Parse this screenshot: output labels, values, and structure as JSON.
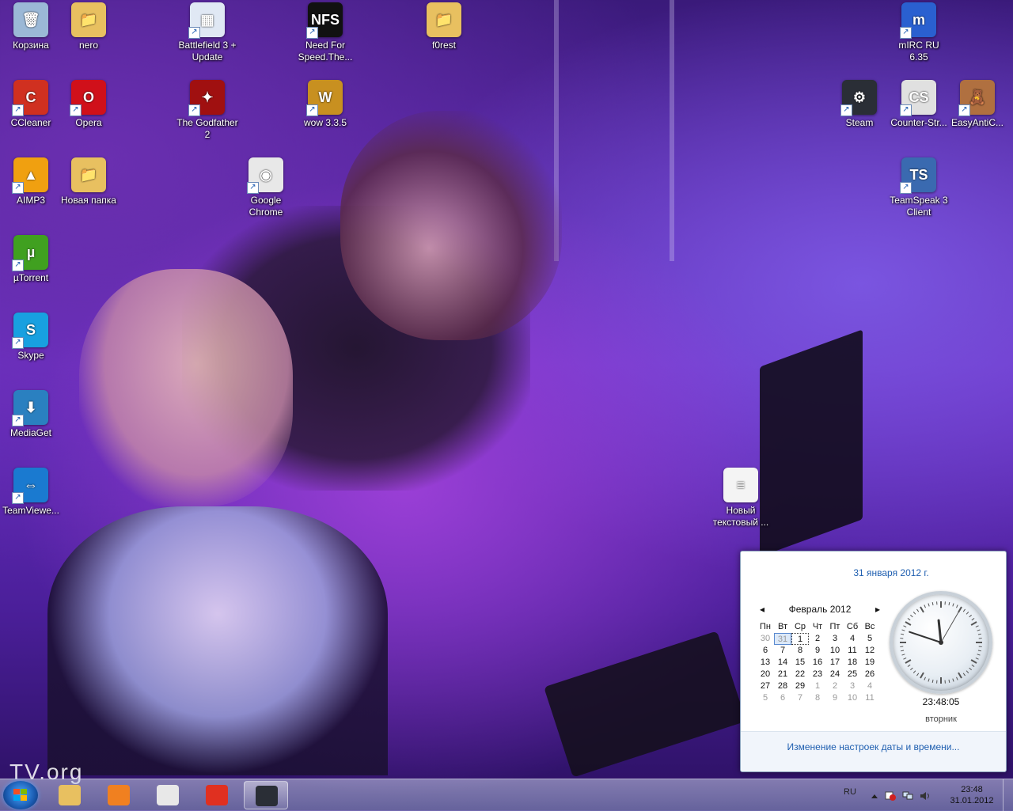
{
  "desktop": {
    "icons": [
      {
        "name": "icon-recycle-bin",
        "label": "Корзина",
        "glyph": "🗑",
        "color": "#9bb8d6"
      },
      {
        "name": "icon-nero",
        "label": "nero",
        "glyph": "📁",
        "color": "#e8c060"
      },
      {
        "name": "icon-battlefield3",
        "label": "Battlefield 3 + Update",
        "glyph": "▦",
        "color": "#e0e8f4"
      },
      {
        "name": "icon-need-for-speed",
        "label": "Need For Speed.The...",
        "glyph": "NFS",
        "color": "#111111"
      },
      {
        "name": "icon-f0rest",
        "label": "f0rest",
        "glyph": "📁",
        "color": "#e8c060"
      },
      {
        "name": "icon-mirc",
        "label": "mIRC RU 6.35",
        "glyph": "m",
        "color": "#2a60d0"
      },
      {
        "name": "icon-ccleaner",
        "label": "CCleaner",
        "glyph": "C",
        "color": "#d03020"
      },
      {
        "name": "icon-opera",
        "label": "Opera",
        "glyph": "O",
        "color": "#d0101a"
      },
      {
        "name": "icon-godfather2",
        "label": "The Godfather 2",
        "glyph": "✦",
        "color": "#a01010"
      },
      {
        "name": "icon-wow",
        "label": "wow 3.3.5",
        "glyph": "W",
        "color": "#c89020"
      },
      {
        "name": "icon-steam-desktop",
        "label": "Steam",
        "glyph": "⚙",
        "color": "#2a2e36"
      },
      {
        "name": "icon-counter-strike",
        "label": "Counter-Str...",
        "glyph": "CS",
        "color": "#e0e0e0"
      },
      {
        "name": "icon-easyanticheat",
        "label": "EasyAntiC...",
        "glyph": "🧸",
        "color": "#b07040"
      },
      {
        "name": "icon-aimp3",
        "label": "AIMP3",
        "glyph": "▲",
        "color": "#f0a010"
      },
      {
        "name": "icon-new-folder",
        "label": "Новая папка",
        "glyph": "📁",
        "color": "#e8c060"
      },
      {
        "name": "icon-google-chrome",
        "label": "Google Chrome",
        "glyph": "◉",
        "color": "#e8e8e8"
      },
      {
        "name": "icon-teamspeak3",
        "label": "TeamSpeak 3 Client",
        "glyph": "TS",
        "color": "#3a6ab0"
      },
      {
        "name": "icon-utorrent",
        "label": "µTorrent",
        "glyph": "µ",
        "color": "#40a020"
      },
      {
        "name": "icon-skype",
        "label": "Skype",
        "glyph": "S",
        "color": "#18a0e0"
      },
      {
        "name": "icon-mediaget",
        "label": "MediaGet",
        "glyph": "⬇",
        "color": "#2a80c0"
      },
      {
        "name": "icon-teamviewer",
        "label": "TeamViewe...",
        "glyph": "⇔",
        "color": "#1a7ad0"
      },
      {
        "name": "icon-new-text-doc",
        "label": "Новый текстовый ...",
        "glyph": "≡",
        "color": "#f4f4f4"
      }
    ]
  },
  "calendar": {
    "date_header": "31 января 2012 г.",
    "month_title": "Февраль 2012",
    "prev_arrow": "◂",
    "next_arrow": "▸",
    "weekdays": [
      "Пн",
      "Вт",
      "Ср",
      "Чт",
      "Пт",
      "Сб",
      "Вс"
    ],
    "weeks": [
      [
        "30",
        "31",
        "1",
        "2",
        "3",
        "4",
        "5"
      ],
      [
        "6",
        "7",
        "8",
        "9",
        "10",
        "11",
        "12"
      ],
      [
        "13",
        "14",
        "15",
        "16",
        "17",
        "18",
        "19"
      ],
      [
        "20",
        "21",
        "22",
        "23",
        "24",
        "25",
        "26"
      ],
      [
        "27",
        "28",
        "29",
        "1",
        "2",
        "3",
        "4"
      ],
      [
        "5",
        "6",
        "7",
        "8",
        "9",
        "10",
        "11"
      ]
    ],
    "time": "23:48:05",
    "day_of_week": "вторник",
    "clock": {
      "hours": 23,
      "minutes": 48,
      "seconds": 5
    },
    "settings_link": "Изменение настроек даты и времени..."
  },
  "taskbar": {
    "language": "RU",
    "time": "23:48",
    "date": "31.01.2012",
    "pinned": [
      {
        "name": "taskbar-explorer",
        "icon": "folder-icon",
        "color": "#e8c060"
      },
      {
        "name": "taskbar-media-player",
        "icon": "media-player-icon",
        "color": "#f08020"
      },
      {
        "name": "taskbar-steelseries",
        "icon": "steelseries-icon",
        "color": "#e8e8e8"
      },
      {
        "name": "taskbar-chrome",
        "icon": "chrome-icon",
        "color": "#e03020"
      },
      {
        "name": "taskbar-steam",
        "icon": "steam-icon",
        "color": "#2a2e36"
      }
    ]
  },
  "wallpaper": {
    "watermark": "TV.org"
  }
}
